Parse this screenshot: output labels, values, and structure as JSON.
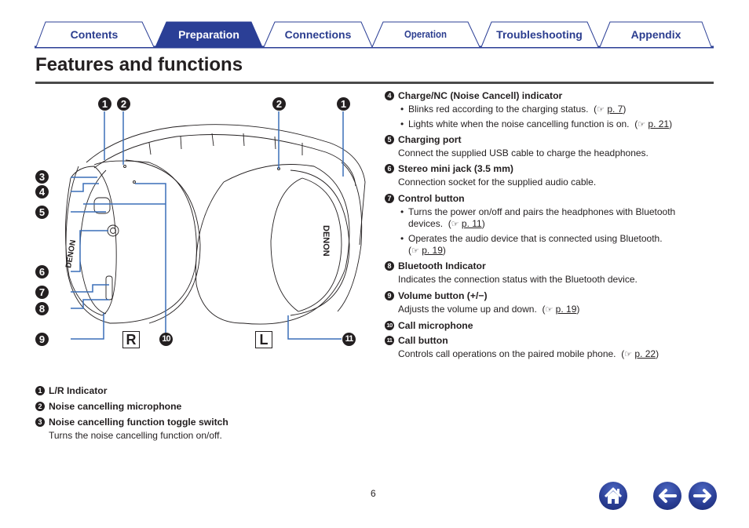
{
  "tabs": [
    {
      "label": "Contents",
      "active": false
    },
    {
      "label": "Preparation",
      "active": true
    },
    {
      "label": "Connections",
      "active": false
    },
    {
      "label": "Operation",
      "active": false
    },
    {
      "label": "Troubleshooting",
      "active": false
    },
    {
      "label": "Appendix",
      "active": false
    }
  ],
  "colors": {
    "brand": "#2b3f96",
    "tab_text": "#2b3d8f",
    "leader_line": "#3a6fb8",
    "text": "#231f20"
  },
  "page": {
    "title": "Features and functions",
    "page_number": "6"
  },
  "figure": {
    "callouts_right": [
      "1",
      "2",
      "3",
      "4",
      "5",
      "6",
      "7",
      "8",
      "9",
      "10"
    ],
    "callouts_left": [
      "2",
      "1",
      "11"
    ],
    "side_right": "R",
    "side_left": "L",
    "brand_text": "DENON"
  },
  "features": [
    {
      "num": "1",
      "title": "L/R Indicator"
    },
    {
      "num": "2",
      "title": "Noise cancelling microphone"
    },
    {
      "num": "3",
      "title": "Noise cancelling function toggle switch",
      "text": "Turns the noise cancelling function on/off."
    },
    {
      "num": "4",
      "title": "Charge/NC (Noise Cancell) indicator",
      "bullets": [
        {
          "text": "Blinks red according to the charging status.",
          "ref": "p. 7"
        },
        {
          "text": "Lights white when the noise cancelling function is on.",
          "ref": "p. 21"
        }
      ]
    },
    {
      "num": "5",
      "title": "Charging port",
      "text": "Connect the supplied USB cable to charge the headphones."
    },
    {
      "num": "6",
      "title": "Stereo mini jack (3.5 mm)",
      "text": "Connection socket for the supplied audio cable."
    },
    {
      "num": "7",
      "title": "Control button",
      "bullets": [
        {
          "text": "Turns the power on/off and pairs the headphones with Bluetooth",
          "text2": "devices.",
          "ref": "p. 11"
        },
        {
          "text": "Operates the audio device that is connected using Bluetooth.",
          "text2": "",
          "ref": "p. 19"
        }
      ]
    },
    {
      "num": "8",
      "title": "Bluetooth Indicator",
      "text": "Indicates the connection status with the Bluetooth device."
    },
    {
      "num": "9",
      "title": "Volume button (+/−)",
      "text": "Adjusts the volume up and down.",
      "ref": "p. 19"
    },
    {
      "num": "10",
      "title": "Call microphone"
    },
    {
      "num": "11",
      "title": "Call button",
      "text": "Controls call operations on the paired mobile phone.",
      "ref": "p. 22"
    }
  ],
  "nav": {
    "home_icon": "home-icon",
    "back_icon": "arrow-left-icon",
    "forward_icon": "arrow-right-icon"
  },
  "ref_icon": "pointing-hand-icon",
  "ref_glyph": "☞"
}
